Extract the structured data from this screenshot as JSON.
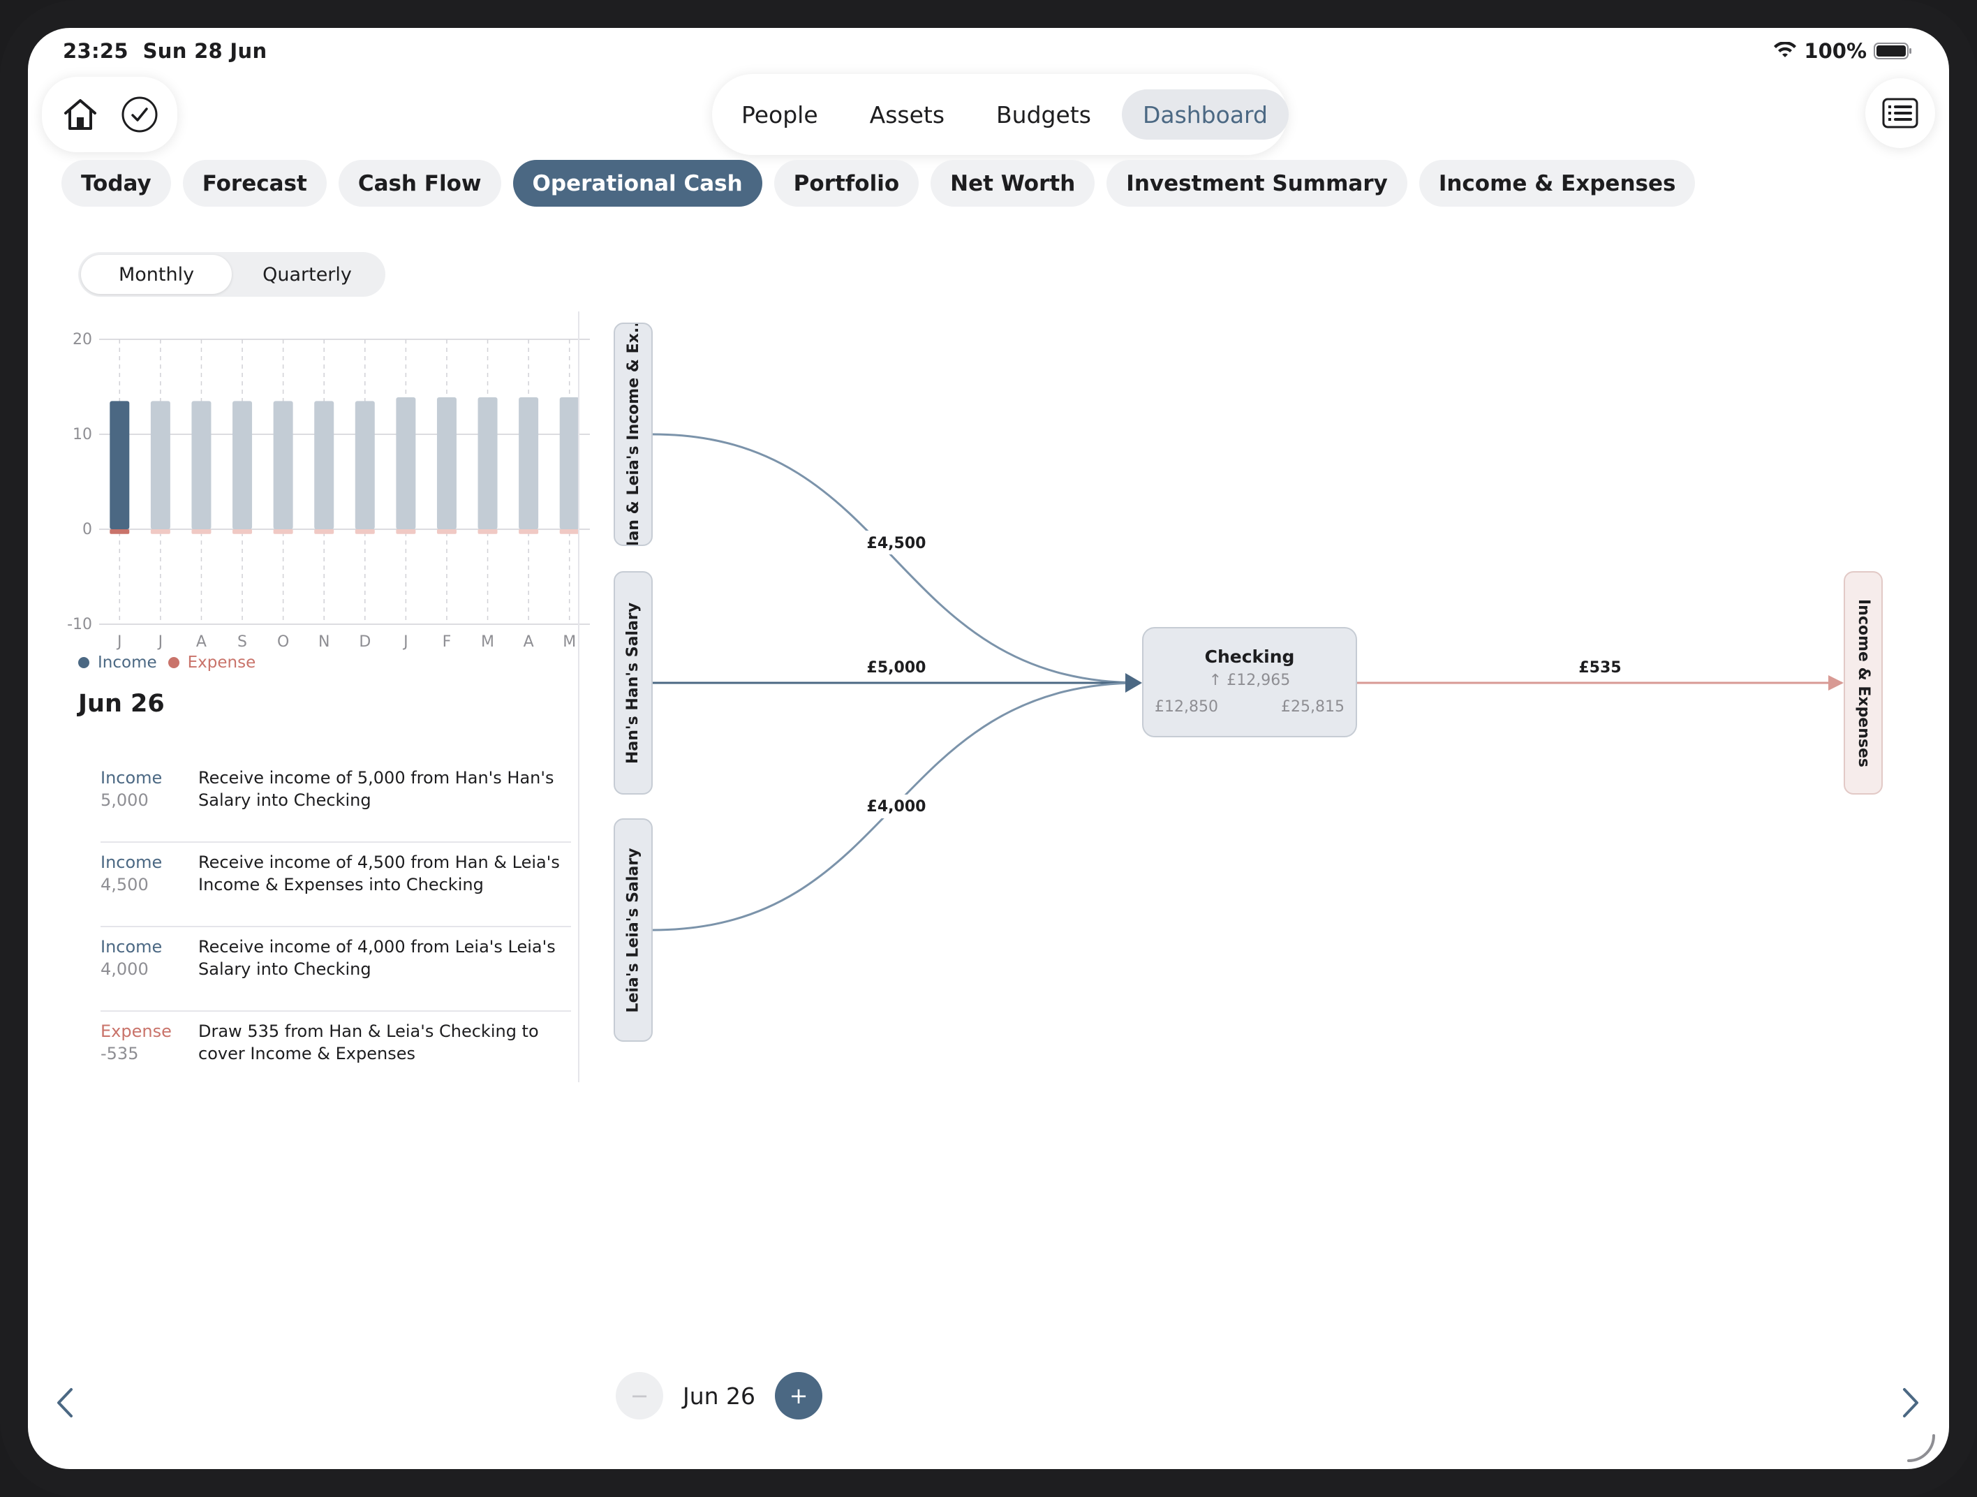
{
  "status_bar": {
    "time": "23:25",
    "date": "Sun 28 Jun",
    "battery": "100%"
  },
  "top_nav": {
    "items": [
      "People",
      "Assets",
      "Budgets",
      "Dashboard"
    ],
    "active": "Dashboard"
  },
  "sub_tabs": {
    "items": [
      "Today",
      "Forecast",
      "Cash Flow",
      "Operational Cash",
      "Portfolio",
      "Net Worth",
      "Investment Summary",
      "Income & Expenses"
    ],
    "active": "Operational Cash"
  },
  "period_toggle": {
    "options": [
      "Monthly",
      "Quarterly"
    ],
    "active": "Monthly"
  },
  "colors": {
    "accent": "#4b6883",
    "income_light": "#c3ccd5",
    "expense": "#c9736a",
    "expense_light": "#f0c9c4",
    "flow_line": "#7b93aa",
    "flow_expense": "#d89a94"
  },
  "chart_data": {
    "type": "bar",
    "categories": [
      "J",
      "J",
      "A",
      "S",
      "O",
      "N",
      "D",
      "J",
      "F",
      "M",
      "A",
      "M"
    ],
    "series": [
      {
        "name": "Income",
        "values": [
          13.5,
          13.5,
          13.5,
          13.5,
          13.5,
          13.5,
          13.5,
          13.9,
          13.9,
          13.9,
          13.9,
          13.9
        ]
      },
      {
        "name": "Expense",
        "values": [
          -0.5,
          -0.5,
          -0.5,
          -0.5,
          -0.5,
          -0.5,
          -0.5,
          -0.5,
          -0.5,
          -0.5,
          -0.5,
          -0.5
        ]
      }
    ],
    "selected_index": 0,
    "ylim": [
      -10,
      20
    ],
    "yticks": [
      20,
      10,
      0,
      -10
    ],
    "grid": true,
    "legend_position": "bottom-left"
  },
  "legend": {
    "income": "Income",
    "expense": "Expense"
  },
  "selected_date": "Jun 26",
  "transactions": [
    {
      "kind": "Income",
      "amount": "5,000",
      "description": "Receive income of 5,000 from Han's Han's Salary into Checking"
    },
    {
      "kind": "Income",
      "amount": "4,500",
      "description": "Receive income of 4,500 from Han & Leia's Income & Expenses into Checking"
    },
    {
      "kind": "Income",
      "amount": "4,000",
      "description": "Receive income of 4,000 from Leia's Leia's Salary into Checking"
    },
    {
      "kind": "Expense",
      "amount": "-535",
      "description": "Draw 535 from Han & Leia's Checking to cover Income & Expenses"
    }
  ],
  "flow": {
    "sources": [
      {
        "name": "Han & Leia's Income & Ex...",
        "amount": "£4,500"
      },
      {
        "name": "Han's Han's Salary",
        "amount": "£5,000"
      },
      {
        "name": "Leia's Leia's Salary",
        "amount": "£4,000"
      }
    ],
    "account": {
      "name": "Checking",
      "change": "↑ £12,965",
      "start": "£12,850",
      "end": "£25,815"
    },
    "target": {
      "name": "Income & Expenses",
      "amount": "£535"
    }
  },
  "date_stepper": {
    "minus": "−",
    "plus": "+",
    "label": "Jun 26"
  }
}
